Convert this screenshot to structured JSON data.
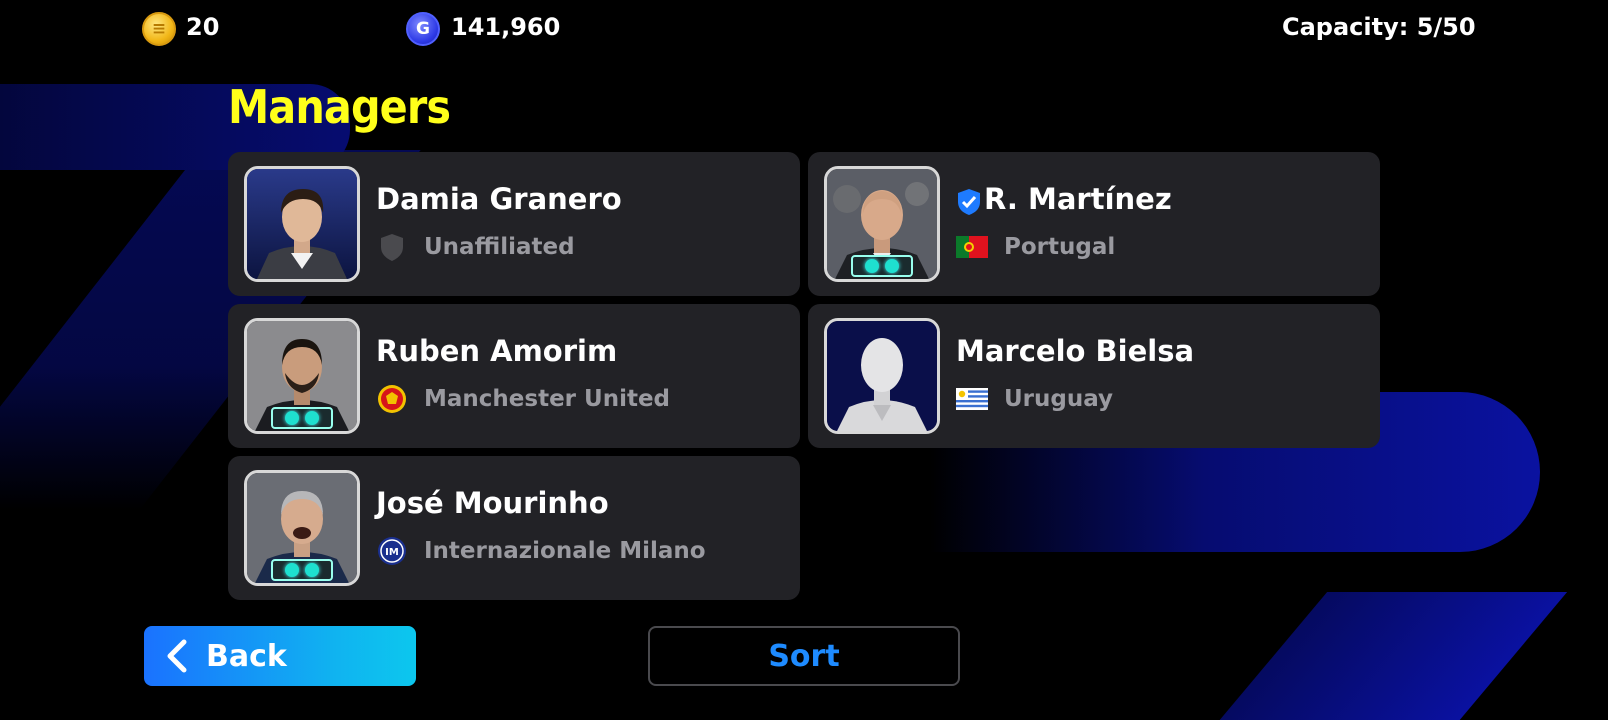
{
  "header": {
    "coins_icon": "efootball-coin-icon",
    "coins_value": "20",
    "gp_icon": "gp-coin-icon",
    "gp_value": "141,960",
    "capacity": "Capacity: 5/50"
  },
  "page": {
    "title": "Managers"
  },
  "managers": [
    {
      "name": "Damia Granero",
      "team": "Unaffiliated",
      "team_icon": "gray-shield-icon",
      "verified": false,
      "has_badge": false
    },
    {
      "name": "R. Martínez",
      "team": "Portugal",
      "team_icon": "portugal-flag-icon",
      "verified": true,
      "has_badge": true
    },
    {
      "name": "Ruben Amorim",
      "team": "Manchester United",
      "team_icon": "manchester-united-crest-icon",
      "verified": false,
      "has_badge": true
    },
    {
      "name": "Marcelo Bielsa",
      "team": "Uruguay",
      "team_icon": "uruguay-flag-icon",
      "verified": false,
      "has_badge": false
    },
    {
      "name": "José Mourinho",
      "team": "Internazionale Milano",
      "team_icon": "inter-milan-crest-icon",
      "verified": false,
      "has_badge": true
    }
  ],
  "buttons": {
    "back_label": "Back",
    "sort_label": "Sort"
  },
  "colors": {
    "title": "#ffff1a",
    "back_gradient_start": "#1a72ff",
    "back_gradient_end": "#0cc7ee",
    "sort_text": "#1e8bff",
    "card_bg": "#222226"
  }
}
